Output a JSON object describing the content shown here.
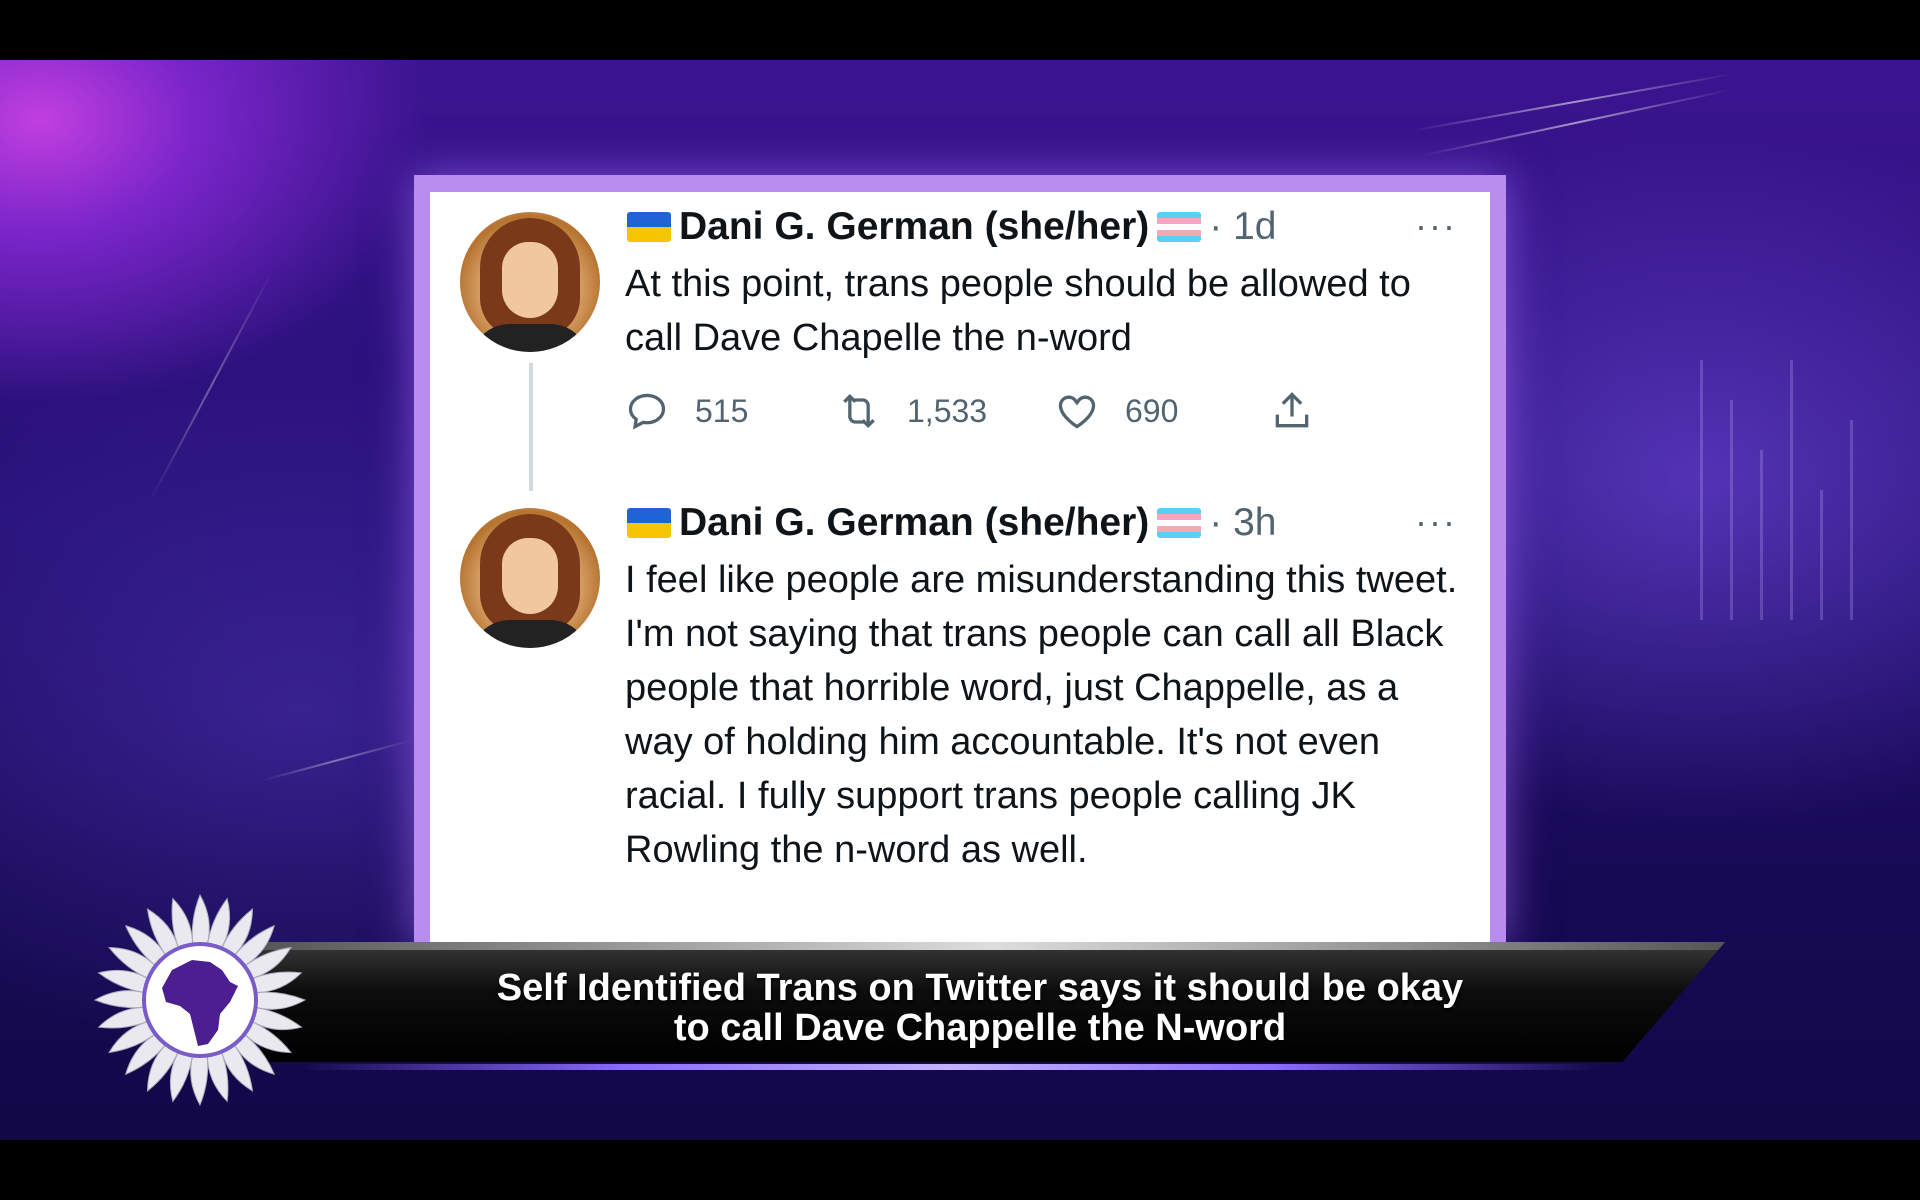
{
  "tweets": [
    {
      "name": "Dani G. German (she/her)",
      "time": "· 1d",
      "text": "At this point, trans people should be allowed to call Dave Chapelle the n-word",
      "replies": "515",
      "retweets": "1,533",
      "likes": "690",
      "more": "···"
    },
    {
      "name": "Dani G. German (she/her)",
      "time": "· 3h",
      "text": "I feel like people are misunderstanding this tweet. I'm not saying that trans people can call all Black people that horrible word, just Chappelle, as a way of holding him accountable. It's not even racial. I fully support trans people calling JK Rowling the n-word as well.",
      "more": "···"
    }
  ],
  "lower_third": {
    "line1": "Self Identified Trans on Twitter says it should be okay",
    "line2": "to call Dave Chappelle the N-word"
  },
  "icons": [
    "ukraine-flag-icon",
    "trans-flag-icon",
    "reply-icon",
    "retweet-icon",
    "like-icon",
    "share-icon",
    "africa-logo-icon"
  ],
  "colors": {
    "accent": "#b98cf0",
    "background": "#241073",
    "text": "#0f1419",
    "muted": "#536471"
  }
}
